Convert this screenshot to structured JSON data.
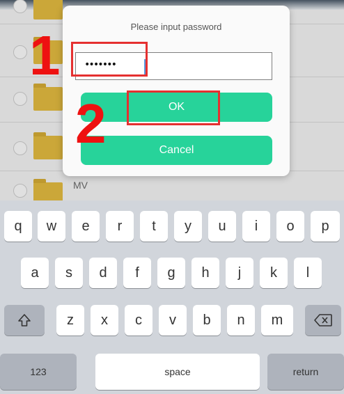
{
  "file_list": {
    "items": [
      {
        "name": ""
      },
      {
        "name": ""
      },
      {
        "name": ""
      },
      {
        "name": "MV"
      }
    ]
  },
  "dialog": {
    "title": "Please input password",
    "password_value": "•••••••",
    "ok_label": "OK",
    "cancel_label": "Cancel",
    "button_color": "#27d39a"
  },
  "annotations": {
    "step1": "1",
    "step2": "2",
    "highlight_color": "#e53030"
  },
  "keyboard": {
    "row1": [
      "q",
      "w",
      "e",
      "r",
      "t",
      "y",
      "u",
      "i",
      "o",
      "p"
    ],
    "row2": [
      "a",
      "s",
      "d",
      "f",
      "g",
      "h",
      "j",
      "k",
      "l"
    ],
    "row3": [
      "z",
      "x",
      "c",
      "v",
      "b",
      "n",
      "m"
    ],
    "shift_icon": "shift-icon",
    "delete_icon": "backspace-icon",
    "numbers_label": "123",
    "space_label": "space",
    "return_label": "return"
  }
}
